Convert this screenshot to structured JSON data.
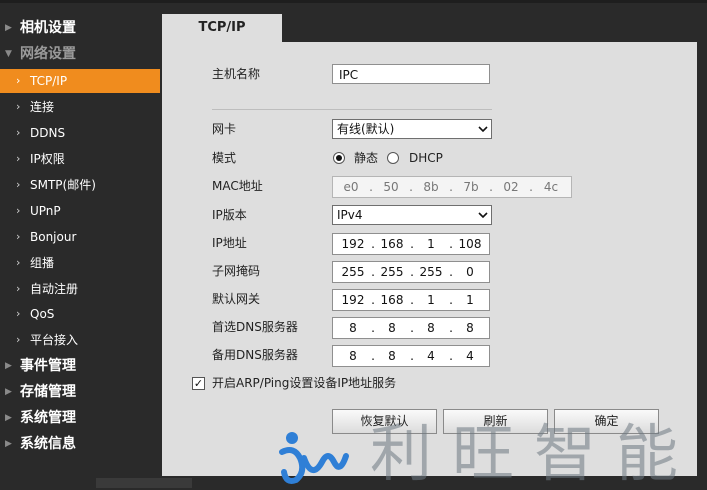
{
  "sidebar": {
    "sections": [
      {
        "label": "相机设置"
      },
      {
        "label": "网络设置"
      },
      {
        "label": "事件管理"
      },
      {
        "label": "存储管理"
      },
      {
        "label": "系统管理"
      },
      {
        "label": "系统信息"
      }
    ],
    "network_items": [
      {
        "label": "TCP/IP"
      },
      {
        "label": "连接"
      },
      {
        "label": "DDNS"
      },
      {
        "label": "IP权限"
      },
      {
        "label": "SMTP(邮件)"
      },
      {
        "label": "UPnP"
      },
      {
        "label": "Bonjour"
      },
      {
        "label": "组播"
      },
      {
        "label": "自动注册"
      },
      {
        "label": "QoS"
      },
      {
        "label": "平台接入"
      }
    ],
    "active_item": "TCP/IP",
    "accent_color": "#f08c1e"
  },
  "tab": {
    "label": "TCP/IP"
  },
  "form": {
    "hostname": {
      "label": "主机名称",
      "value": "IPC"
    },
    "nic": {
      "label": "网卡",
      "value": "有线(默认)"
    },
    "mode": {
      "label": "模式",
      "options": [
        "静态",
        "DHCP"
      ],
      "selected": "静态"
    },
    "mac": {
      "label": "MAC地址",
      "octets": [
        "e0",
        "50",
        "8b",
        "7b",
        "02",
        "4c"
      ]
    },
    "ip_version": {
      "label": "IP版本",
      "value": "IPv4"
    },
    "ip": {
      "label": "IP地址",
      "octets": [
        "192",
        "168",
        "1",
        "108"
      ]
    },
    "mask": {
      "label": "子网掩码",
      "octets": [
        "255",
        "255",
        "255",
        "0"
      ]
    },
    "gateway": {
      "label": "默认网关",
      "octets": [
        "192",
        "168",
        "1",
        "1"
      ]
    },
    "dns1": {
      "label": "首选DNS服务器",
      "octets": [
        "8",
        "8",
        "8",
        "8"
      ]
    },
    "dns2": {
      "label": "备用DNS服务器",
      "octets": [
        "8",
        "8",
        "4",
        "4"
      ]
    },
    "arp": {
      "label": "开启ARP/Ping设置设备IP地址服务",
      "checked": true
    }
  },
  "buttons": {
    "restore": "恢复默认",
    "refresh": "刷新",
    "ok": "确定"
  },
  "watermark": {
    "text": "利旺智能"
  }
}
